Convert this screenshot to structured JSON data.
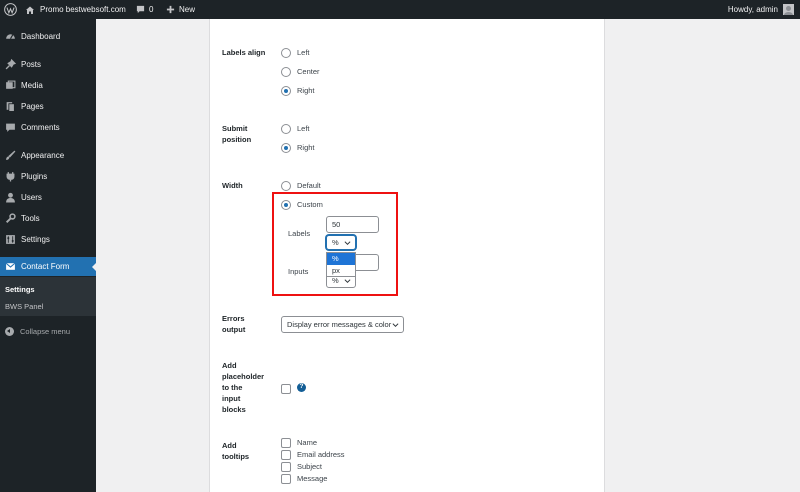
{
  "adminbar": {
    "site_name": "Promo bestwebsoft.com",
    "comments_count": "0",
    "new_label": "New",
    "greeting": "Howdy, admin"
  },
  "sidebar": {
    "items": [
      {
        "label": "Dashboard",
        "icon": "dashboard-icon"
      },
      {
        "label": "Posts",
        "icon": "pin-icon"
      },
      {
        "label": "Media",
        "icon": "media-icon"
      },
      {
        "label": "Pages",
        "icon": "pages-icon"
      },
      {
        "label": "Comments",
        "icon": "comment-icon"
      },
      {
        "label": "Appearance",
        "icon": "brush-icon"
      },
      {
        "label": "Plugins",
        "icon": "plug-icon"
      },
      {
        "label": "Users",
        "icon": "user-icon"
      },
      {
        "label": "Tools",
        "icon": "wrench-icon"
      },
      {
        "label": "Settings",
        "icon": "sliders-icon"
      },
      {
        "label": "Contact Form",
        "icon": "envelope-icon"
      }
    ],
    "submenu": [
      "Settings",
      "BWS Panel"
    ],
    "collapse_label": "Collapse menu"
  },
  "form": {
    "labels_align": {
      "label": "Labels align",
      "options": [
        "Left",
        "Center",
        "Right"
      ],
      "selected": "Right"
    },
    "submit_position": {
      "label_line1": "Submit",
      "label_line2": "position",
      "options": [
        "Left",
        "Right"
      ],
      "selected": "Right"
    },
    "width": {
      "label": "Width",
      "options": [
        "Default",
        "Custom"
      ],
      "selected": "Custom",
      "labels_label": "Labels",
      "labels_value": "50",
      "labels_unit": "%",
      "inputs_label": "Inputs",
      "inputs_unit": "%",
      "unit_options": [
        "%",
        "px"
      ],
      "highlighted_unit": "%"
    },
    "errors_output": {
      "label_line1": "Errors",
      "label_line2": "output",
      "value": "Display error messages & color"
    },
    "placeholder": {
      "label_lines": [
        "Add",
        "placeholder",
        "to the",
        "input",
        "blocks"
      ],
      "help": "?"
    },
    "tooltips": {
      "label_line1": "Add",
      "label_line2": "tooltips",
      "options": [
        "Name",
        "Email address",
        "Subject",
        "Message"
      ]
    }
  },
  "colors": {
    "admin_bar": "#1d2327",
    "sidebar": "#1d2327",
    "accent": "#2271b1",
    "highlight": "#ee1111"
  }
}
